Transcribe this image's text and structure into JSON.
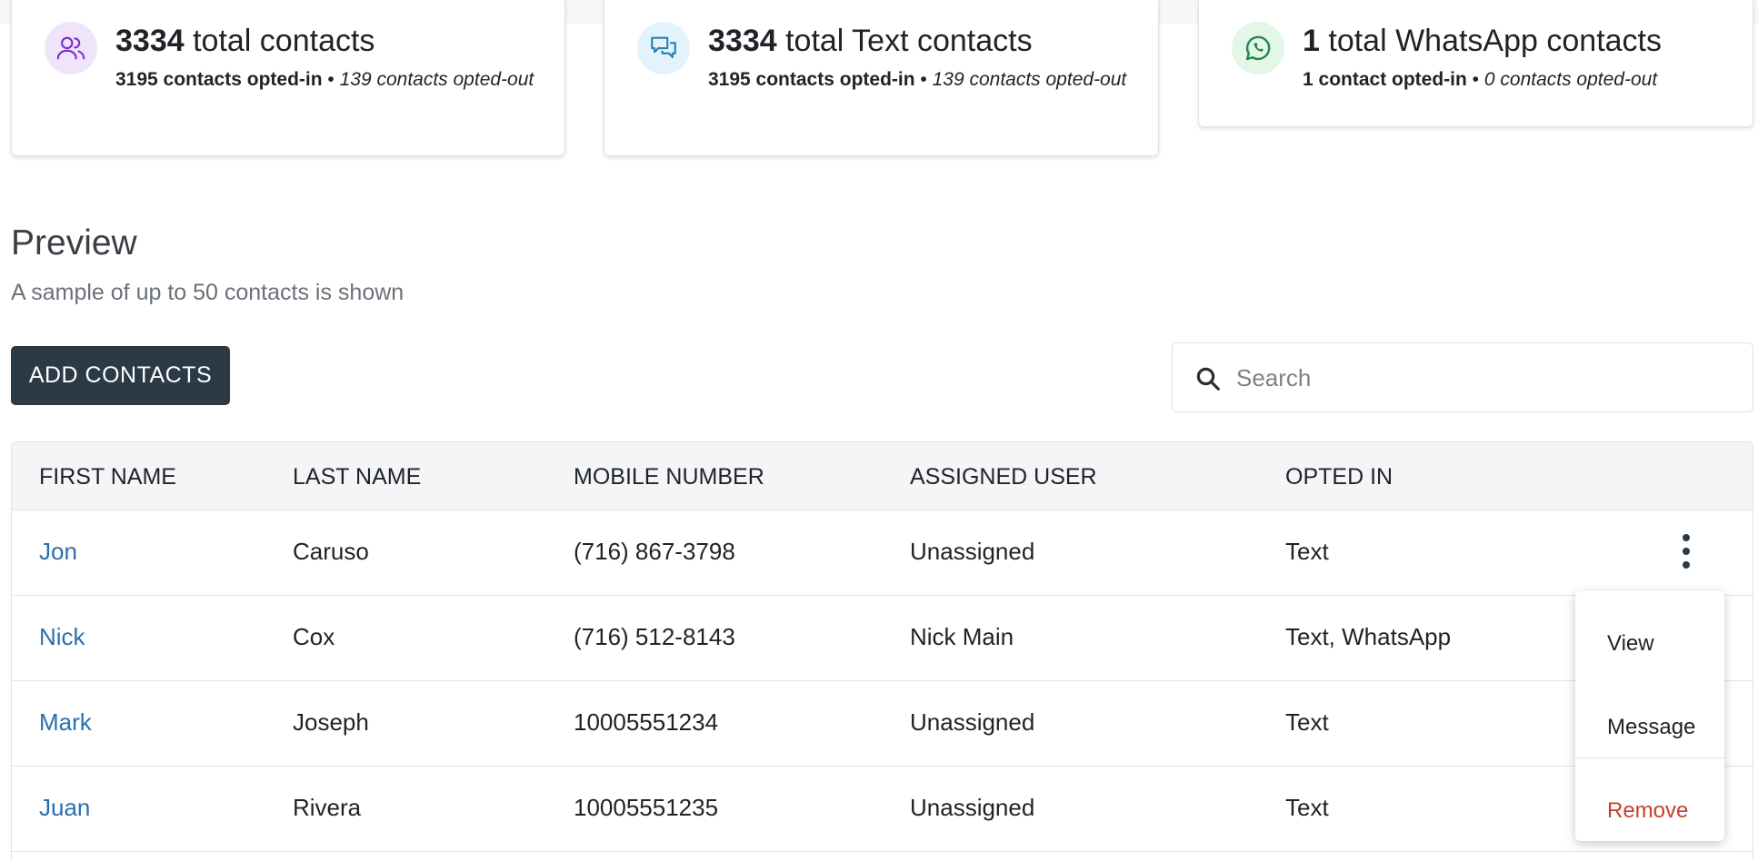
{
  "stats": [
    {
      "count": "3334",
      "title": " total contacts",
      "opted_in": "3195 contacts opted-in",
      "separator": " • ",
      "opted_out": "139 contacts opted-out",
      "icon": "users-icon",
      "color": "#7b2fc7"
    },
    {
      "count": "3334",
      "title": " total Text contacts",
      "opted_in": "3195 contacts opted-in",
      "separator": " • ",
      "opted_out": "139 contacts opted-out",
      "icon": "chat-icon",
      "color": "#2a7fb0"
    },
    {
      "count": "1",
      "title": " total WhatsApp contacts",
      "opted_in": "1 contact opted-in",
      "separator": " • ",
      "opted_out": "0 contacts opted-out",
      "icon": "whatsapp-icon",
      "color": "#1f8a4a"
    }
  ],
  "preview": {
    "title": "Preview",
    "subtitle": "A sample of up to 50 contacts is shown",
    "add_button": "ADD CONTACTS",
    "search_placeholder": "Search"
  },
  "table": {
    "headers": [
      "FIRST NAME",
      "LAST NAME",
      "MOBILE NUMBER",
      "ASSIGNED USER",
      "OPTED IN"
    ],
    "rows": [
      [
        "Jon",
        "Caruso",
        "(716) 867-3798",
        "Unassigned",
        "Text"
      ],
      [
        "Nick",
        "Cox",
        "(716) 512-8143",
        "Nick Main",
        "Text, WhatsApp"
      ],
      [
        "Mark",
        "Joseph",
        "10005551234",
        "Unassigned",
        "Text"
      ],
      [
        "Juan",
        "Rivera",
        "10005551235",
        "Unassigned",
        "Text"
      ]
    ]
  },
  "row_menu": {
    "view": "View",
    "message": "Message",
    "remove": "Remove"
  },
  "colors": {
    "primary_button": "#2b3a47",
    "link": "#2a6fb0",
    "danger": "#c8402c"
  }
}
